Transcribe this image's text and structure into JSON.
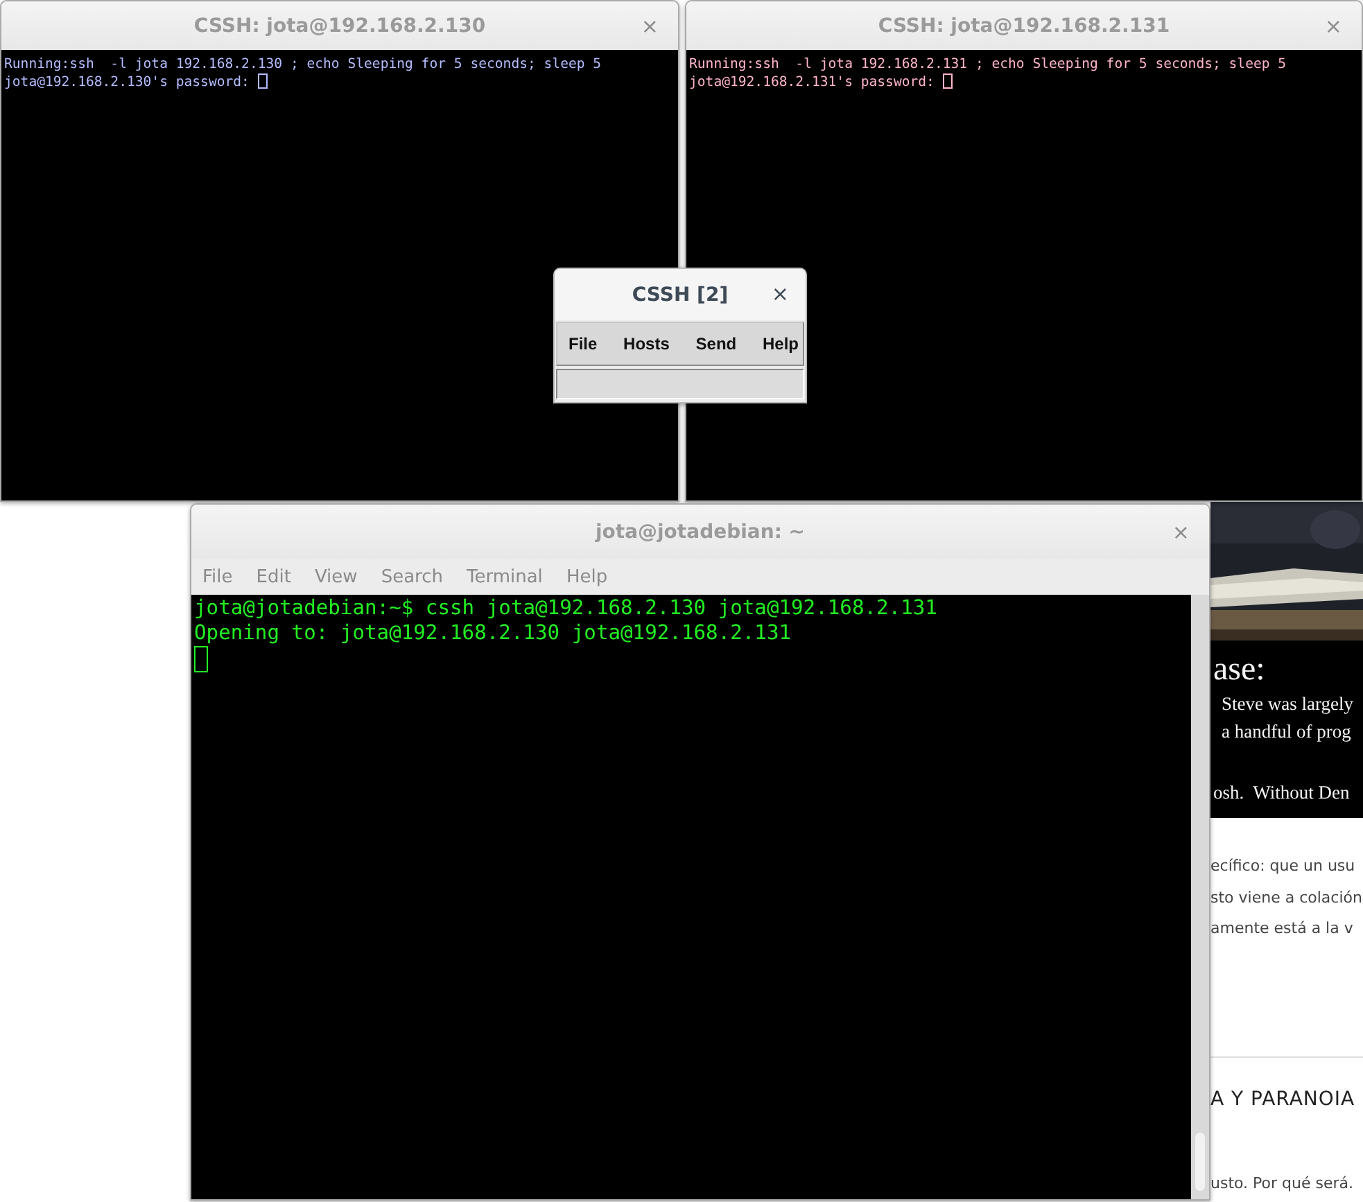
{
  "background_page": {
    "quote_heading": "ase:",
    "quote_lines": [
      "Steve was largely",
      "a handful of prog",
      "osh.  Without Den"
    ],
    "paragraph_lines": [
      "ecífico: que un usu",
      "sto viene a colación",
      "amente está a la v"
    ],
    "heading": "A Y PARANOIA",
    "footer_line": "usto. Por qué será."
  },
  "windows": [
    {
      "kind": "cssh",
      "title": "CSSH: jota@192.168.2.130",
      "close": "×",
      "color": "#b4bcff",
      "lines": [
        "Running:ssh  -l jota 192.168.2.130 ; echo Sleeping for 5 seconds; sleep 5",
        "jota@192.168.2.130's password: "
      ]
    },
    {
      "kind": "cssh",
      "title": "CSSH: jota@192.168.2.131",
      "close": "×",
      "color": "#ffb4cc",
      "lines": [
        "Running:ssh  -l jota 192.168.2.131 ; echo Sleeping for 5 seconds; sleep 5",
        "jota@192.168.2.131's password: "
      ]
    },
    {
      "kind": "control",
      "title": "CSSH [2]",
      "close": "×",
      "menu": [
        "File",
        "Hosts",
        "Send",
        "Help"
      ]
    },
    {
      "kind": "gnome_terminal",
      "title": "jota@jotadebian: ~",
      "close": "×",
      "menu": [
        "File",
        "Edit",
        "View",
        "Search",
        "Terminal",
        "Help"
      ],
      "color": "#22ee22",
      "lines": [
        "jota@jotadebian:~$ cssh jota@192.168.2.130 jota@192.168.2.131",
        "Opening to: jota@192.168.2.130 jota@192.168.2.131"
      ]
    }
  ]
}
